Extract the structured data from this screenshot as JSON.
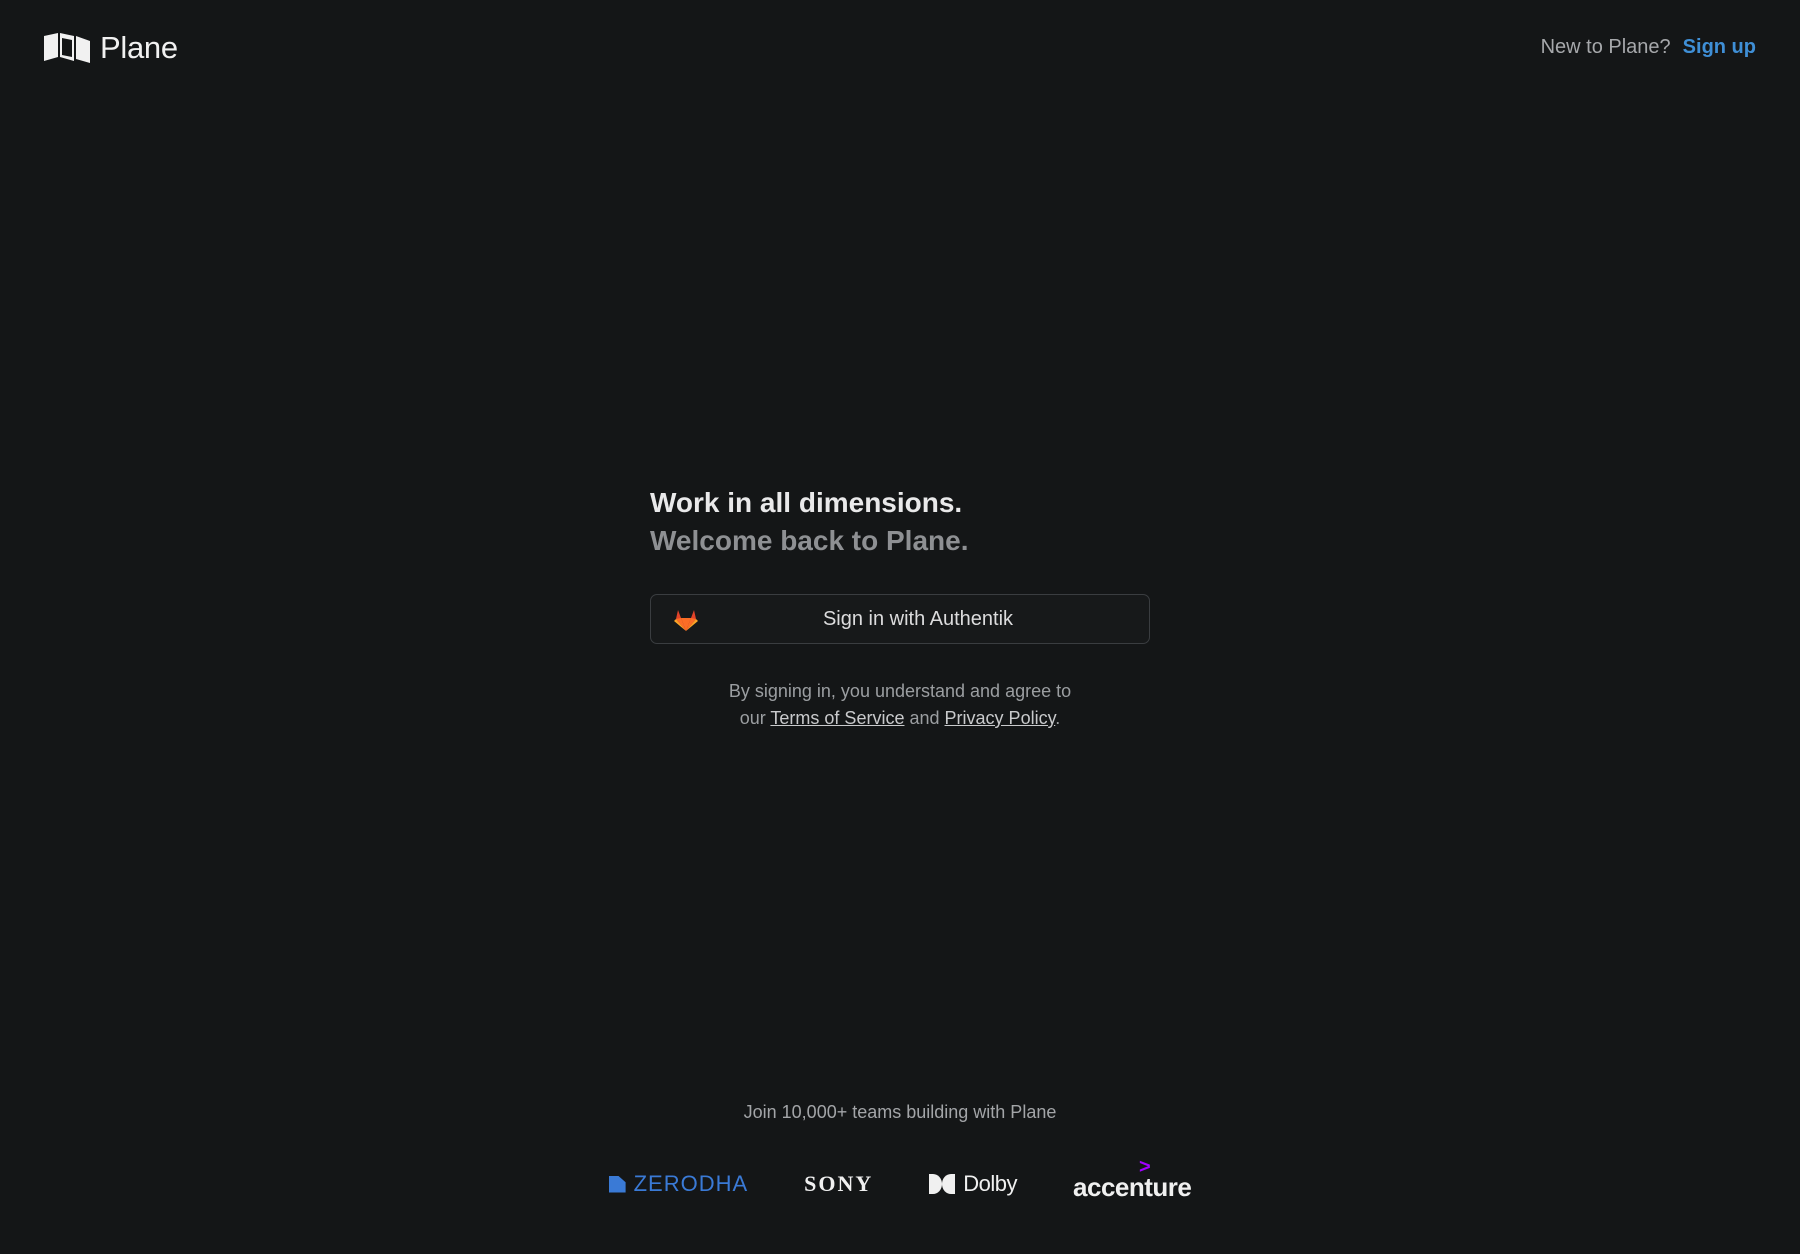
{
  "header": {
    "brand_name": "Plane",
    "signup_prompt": "New to Plane?",
    "signup_link": "Sign up"
  },
  "auth": {
    "headline": "Work in all dimensions.",
    "subheadline": "Welcome back to Plane.",
    "sso_button_label": "Sign in with Authentik",
    "sso_icon": "gitlab-fox-icon",
    "legal_line1": "By signing in, you understand and agree to",
    "legal_our": "our",
    "terms_link": "Terms of Service",
    "legal_and": "and",
    "privacy_link": "Privacy Policy",
    "legal_period": "."
  },
  "footer": {
    "tagline": "Join 10,000+ teams building with Plane",
    "logos": {
      "zerodha": "ZERODHA",
      "sony": "SONY",
      "dolby": "Dolby",
      "accenture": "accenture",
      "accenture_caret": ">"
    }
  },
  "colors": {
    "background": "#141617",
    "accent": "#3f8fd6",
    "zerodha_blue": "#3a7ad6",
    "accenture_purple": "#a100ff"
  }
}
